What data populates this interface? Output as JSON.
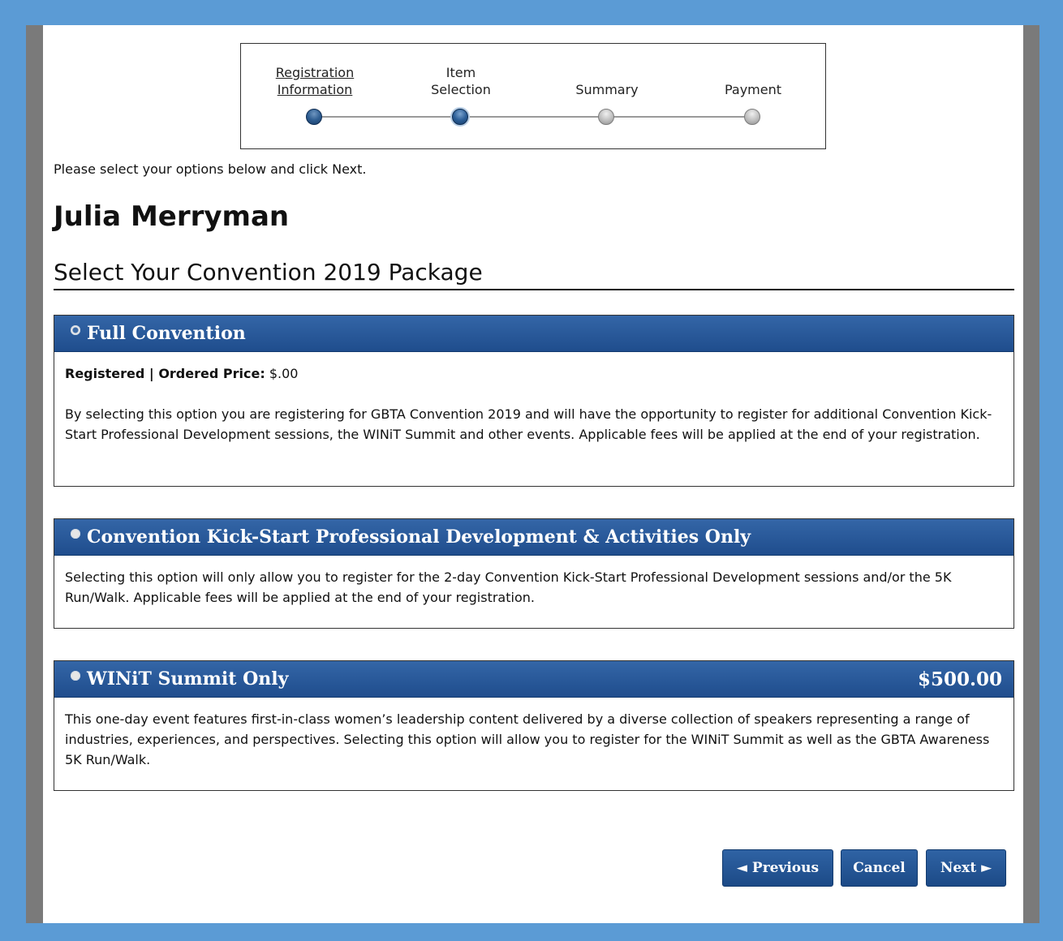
{
  "tracker": {
    "steps": [
      {
        "label_line1": "Registration",
        "label_line2": "Information",
        "state": "done"
      },
      {
        "label_line1": "Item",
        "label_line2": "Selection",
        "state": "current"
      },
      {
        "label_line1": "",
        "label_line2": "Summary",
        "state": "todo"
      },
      {
        "label_line1": "",
        "label_line2": "Payment",
        "state": "todo"
      }
    ]
  },
  "intro_text": "Please select your options below and click Next.",
  "attendee_name": "Julia Merryman",
  "section_title": "Select Your Convention 2019 Package",
  "options": [
    {
      "title": "Full Convention",
      "selected": true,
      "price": "",
      "status_label": "Registered | Ordered Price:",
      "status_value": "$.00",
      "description": "By selecting this option you are registering for GBTA Convention 2019 and will have the opportunity to register for additional Convention Kick-Start Professional Development sessions, the WINiT Summit and other events. Applicable fees will be applied at the end of your registration."
    },
    {
      "title": "Convention Kick-Start Professional Development & Activities Only",
      "selected": false,
      "price": "",
      "description": "Selecting this option will only allow you to register for the 2-day Convention Kick-Start Professional Development sessions and/or the 5K Run/Walk. Applicable fees will be applied at the end of your registration."
    },
    {
      "title": "WINiT Summit Only",
      "selected": false,
      "price": "$500.00",
      "description": "This one-day event features first-in-class women’s leadership content delivered by a diverse collection of speakers representing a range of industries, experiences, and perspectives. Selecting this option will allow you to register for the WINiT Summit as well as the GBTA Awareness 5K Run/Walk."
    }
  ],
  "buttons": {
    "previous": "◄ Previous",
    "cancel": "Cancel",
    "next": "Next ►"
  },
  "colors": {
    "page_background": "#5b9bd5",
    "header_blue": "#2a5a9a",
    "button_blue": "#255696"
  }
}
